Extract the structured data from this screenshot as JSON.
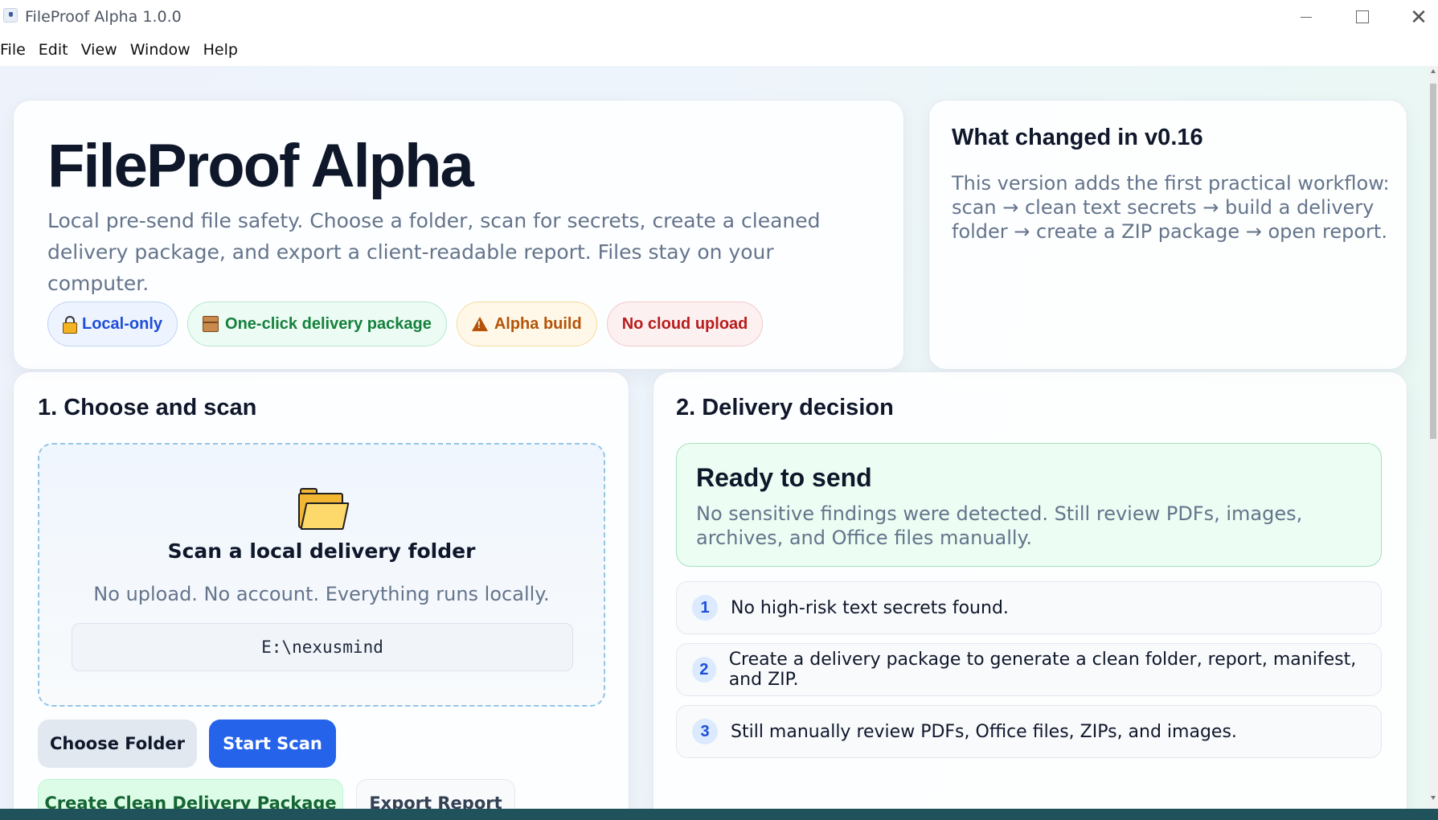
{
  "window": {
    "title": "FileProof Alpha 1.0.0"
  },
  "menu": [
    "File",
    "Edit",
    "View",
    "Window",
    "Help"
  ],
  "hero": {
    "title": "FileProof Alpha",
    "subtitle": "Local pre-send file safety. Choose a folder, scan for secrets, create a cleaned delivery package, and export a client-readable report. Files stay on your computer.",
    "pills": [
      {
        "label": "Local-only",
        "icon": "lock-icon"
      },
      {
        "label": "One-click delivery package",
        "icon": "package-icon"
      },
      {
        "label": "Alpha build",
        "icon": "warning-icon"
      },
      {
        "label": "No cloud upload"
      }
    ]
  },
  "changes": {
    "title": "What changed in v0.16",
    "body": "This version adds the first practical workflow: scan → clean text secrets → build a delivery folder → create a ZIP package → open report."
  },
  "scan": {
    "title": "1. Choose and scan",
    "dropzone_title": "Scan a local delivery folder",
    "dropzone_sub": "No upload. No account. Everything runs locally.",
    "path": "E:\\nexusmind",
    "choose_button": "Choose Folder",
    "scan_button": "Start Scan",
    "clean_button": "Create Clean Delivery Package",
    "export_button": "Export Report"
  },
  "decision": {
    "title": "2. Delivery decision",
    "status_title": "Ready to send",
    "status_body": "No sensitive findings were detected. Still review PDFs, images, archives, and Office files manually.",
    "steps": [
      {
        "num": "1",
        "text": "No high-risk text secrets found."
      },
      {
        "num": "2",
        "text": "Create a delivery package to generate a clean folder, report, manifest, and ZIP."
      },
      {
        "num": "3",
        "text": "Still manually review PDFs, Office files, ZIPs, and images."
      }
    ]
  },
  "colors": {
    "primary": "#2563eb",
    "success_bg": "#ecfdf3",
    "warning": "#b45309",
    "danger": "#b91c1c"
  }
}
